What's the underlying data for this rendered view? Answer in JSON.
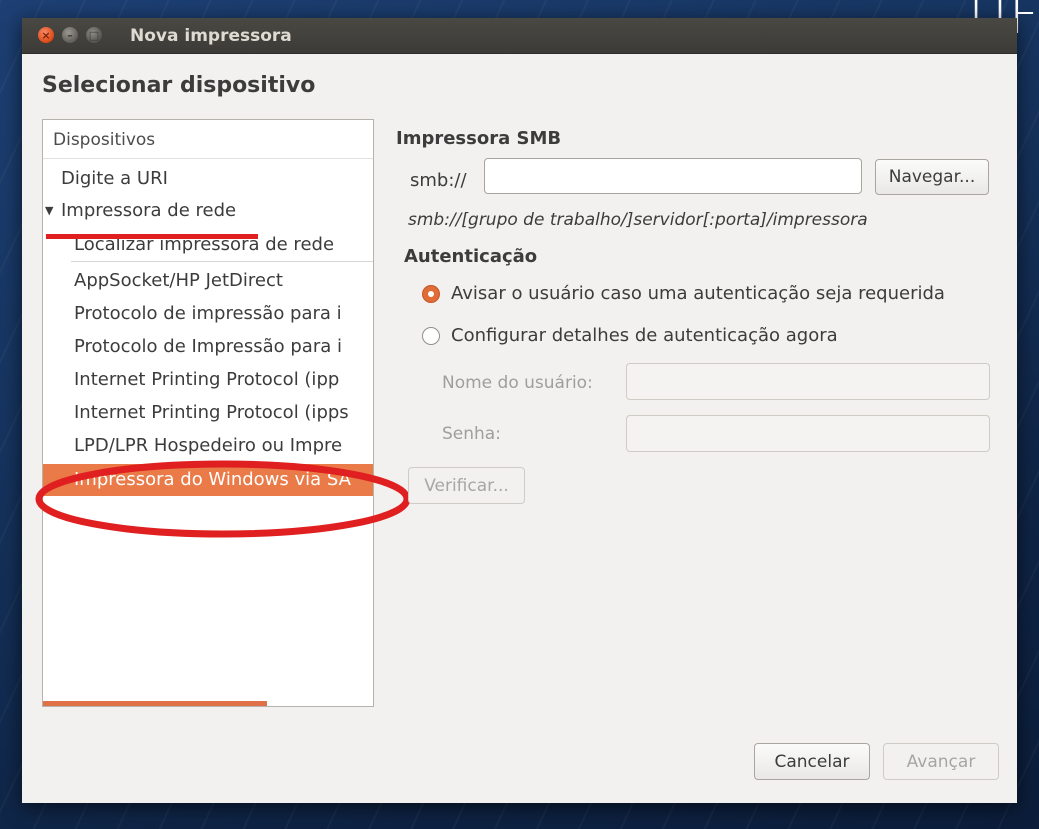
{
  "window": {
    "title": "Nova impressora"
  },
  "heading": "Selecionar dispositivo",
  "device_list": {
    "header": "Dispositivos",
    "items": [
      {
        "label": "Digite a URI",
        "level": 0
      },
      {
        "label": "Impressora de rede",
        "level": 0,
        "expanded": true
      },
      {
        "label": "Localizar impressora de rede",
        "level": 1
      },
      {
        "label": "AppSocket/HP JetDirect",
        "level": 1
      },
      {
        "label": "Protocolo de impressão para i",
        "level": 1
      },
      {
        "label": "Protocolo de Impressão para i",
        "level": 1
      },
      {
        "label": "Internet Printing Protocol (ipp",
        "level": 1
      },
      {
        "label": "Internet Printing Protocol (ipps",
        "level": 1
      },
      {
        "label": "LPD/LPR Hospedeiro ou Impre",
        "level": 1
      },
      {
        "label": "Impressora do Windows via SA",
        "level": 1,
        "selected": true
      }
    ],
    "expander_glyph": "▼",
    "scroll_fraction": 0.68
  },
  "smb": {
    "title": "Impressora SMB",
    "prefix": "smb://",
    "uri_value": "",
    "browse_label": "Navegar...",
    "hint": "smb://[grupo de trabalho/]servidor[:porta]/impressora"
  },
  "auth": {
    "title": "Autenticação",
    "options": [
      {
        "label": "Avisar o usuário caso uma autenticação seja requerida",
        "checked": true
      },
      {
        "label": "Configurar detalhes de autenticação agora",
        "checked": false
      }
    ],
    "username_label": "Nome do usuário:",
    "username_value": "",
    "password_label": "Senha:",
    "password_value": "",
    "verify_label": "Verificar..."
  },
  "footer": {
    "cancel_label": "Cancelar",
    "next_label": "Avançar"
  },
  "corner_logo": "UF",
  "colors": {
    "accent": "#ea7a48",
    "annotation_red": "#e02020",
    "titlebar": "#3c3b37",
    "window_bg": "#f2f1f0"
  }
}
